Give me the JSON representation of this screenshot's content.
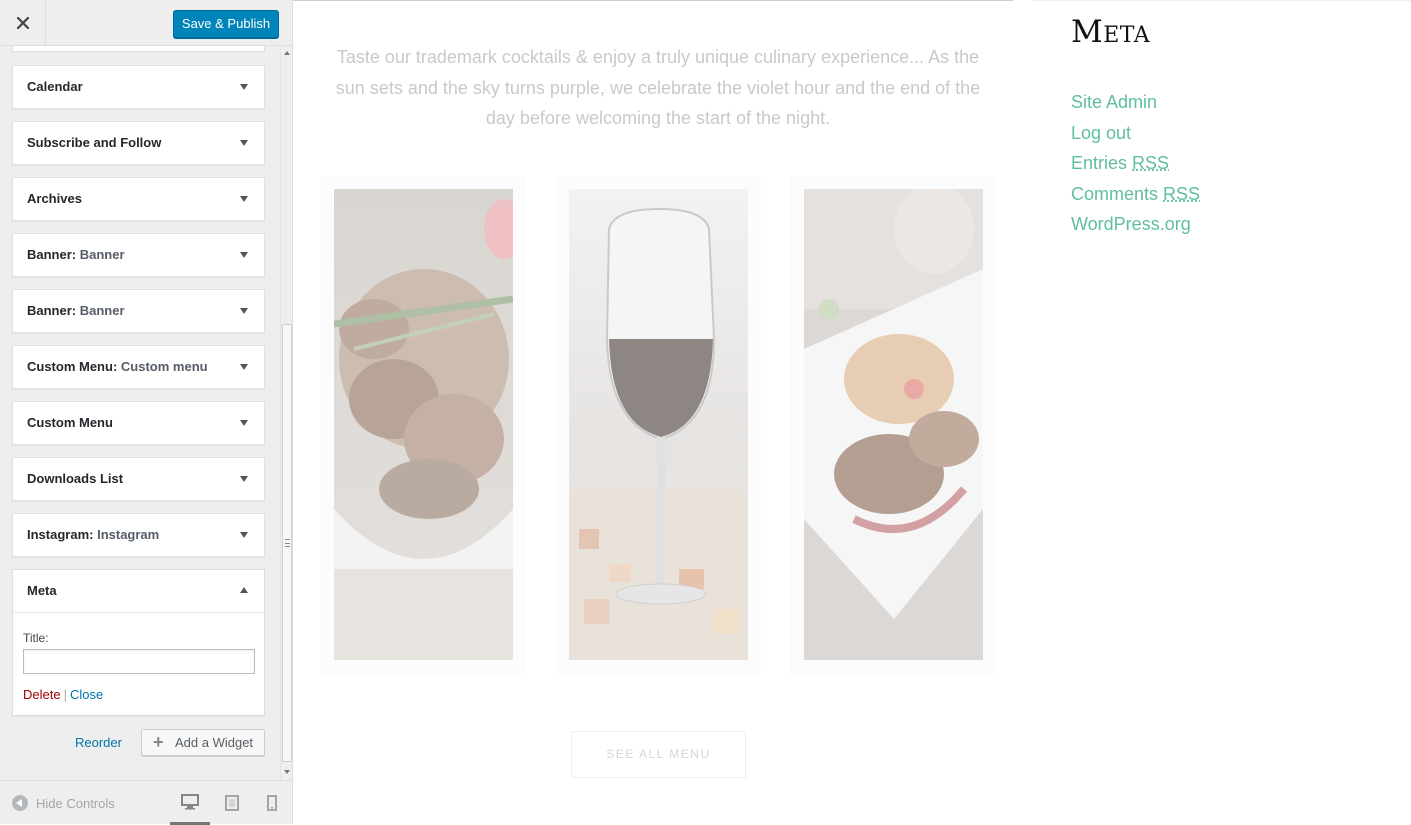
{
  "sidebar": {
    "close_label": "×",
    "publish_label": "Save & Publish",
    "widgets": [
      {
        "title": "Calendar",
        "subtitle": ""
      },
      {
        "title": "Subscribe and Follow",
        "subtitle": ""
      },
      {
        "title": "Archives",
        "subtitle": ""
      },
      {
        "title": "Banner",
        "subtitle": "Banner"
      },
      {
        "title": "Banner",
        "subtitle": "Banner"
      },
      {
        "title": "Custom Menu",
        "subtitle": "Custom menu"
      },
      {
        "title": "Custom Menu",
        "subtitle": ""
      },
      {
        "title": "Downloads List",
        "subtitle": ""
      },
      {
        "title": "Instagram",
        "subtitle": "Instagram"
      }
    ],
    "expanded_widget": {
      "title": "Meta",
      "field_label": "Title:",
      "field_value": "",
      "delete_label": "Delete",
      "separator": "|",
      "close_label": "Close"
    },
    "reorder_label": "Reorder",
    "add_widget_label": "Add a Widget",
    "hide_controls_label": "Hide Controls",
    "devices": [
      "desktop-icon",
      "tablet-icon",
      "mobile-icon"
    ],
    "active_device": "desktop",
    "colors": {
      "primary": "#0085ba",
      "link": "#0073aa",
      "delete": "#a00000"
    }
  },
  "preview": {
    "intro_text": "Taste our trademark cocktails & enjoy a truly unique culinary experience... As the sun sets and the sky turns purple, we celebrate the violet hour and the end of the day before welcoming the start of the night.",
    "see_all_label": "SEE ALL MENU",
    "meta": {
      "title": "Meta",
      "links": [
        {
          "text": "Site Admin",
          "abbr": ""
        },
        {
          "text": "Log out",
          "abbr": ""
        },
        {
          "text": "Entries ",
          "abbr": "RSS"
        },
        {
          "text": "Comments ",
          "abbr": "RSS"
        },
        {
          "text": "WordPress.org",
          "abbr": ""
        }
      ]
    },
    "colors": {
      "meta_link": "#5fbf9c"
    }
  }
}
